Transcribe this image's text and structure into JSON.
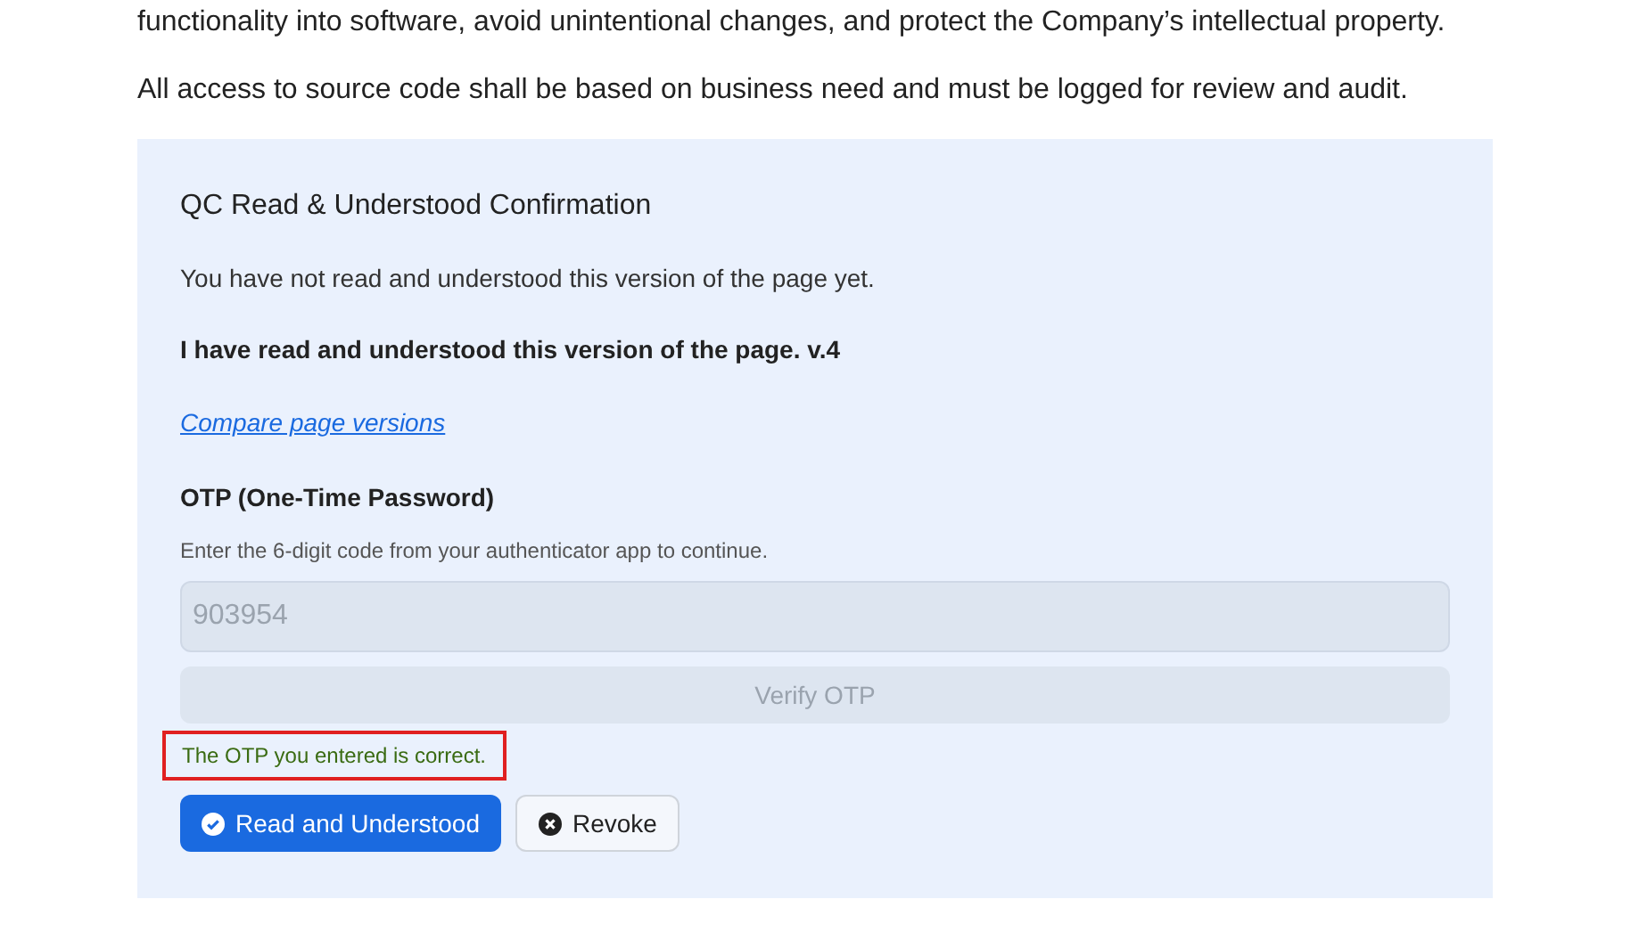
{
  "paragraphs": [
    "functionality into software, avoid unintentional changes, and protect the Company’s intellectual property.",
    "All access to source code shall be based on business need and must be logged for review and audit."
  ],
  "panel": {
    "title": "QC Read & Understood Confirmation",
    "status": "You have not read and understood this version of the page yet.",
    "statement": "I have read and understood this version of the page. v.4",
    "link": "Compare page versions",
    "otp": {
      "label": "OTP (One-Time Password)",
      "hint": "Enter the 6-digit code from your authenticator app to continue.",
      "value": "903954",
      "disabled": true,
      "verify_label": "Verify OTP",
      "verify_disabled": true,
      "message": {
        "text": "The OTP you entered is correct.",
        "kind": "success",
        "highlighted": true
      }
    },
    "buttons": [
      {
        "label": "Read and Understood",
        "kind": "primary"
      },
      {
        "label": "Revoke",
        "kind": "secondary"
      }
    ]
  }
}
